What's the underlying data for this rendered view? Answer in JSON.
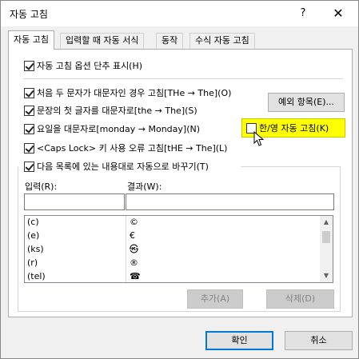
{
  "window": {
    "title": "자동 고침",
    "help": "?",
    "close": "✕"
  },
  "tabs": [
    {
      "label": "자동 고침",
      "active": true
    },
    {
      "label": "입력할 때 자동 서식",
      "active": false
    },
    {
      "label": "동작",
      "active": false
    },
    {
      "label": "수식 자동 고침",
      "active": false
    }
  ],
  "options": {
    "show_buttons": "자동 고침 옵션 단추 표시(H)",
    "two_initial_caps": "처음 두 문자가 대문자인 경우 고침[THe → The](O)",
    "capitalize_sentence": "문장의 첫 글자를 대문자로[the → The](S)",
    "capitalize_days": "요일을 대문자로[monday → Monday](N)",
    "caps_lock": "<Caps Lock> 키 사용 오류 고침[tHE → The](L)",
    "replace_text": "다음 목록에 있는 내용대로 자동으로 바꾸기(T)",
    "hangul_english": "한/영 자동 고침(K)"
  },
  "buttons": {
    "exceptions": "예외 항목(E)...",
    "add": "추가(A)",
    "delete": "삭제(D)",
    "ok": "확인",
    "cancel": "취소"
  },
  "labels": {
    "replace": "입력(R):",
    "with": "결과(W):"
  },
  "fields": {
    "replace_value": "",
    "with_value": ""
  },
  "list": {
    "rows": [
      {
        "input": "(c)",
        "result": "©"
      },
      {
        "input": "(e)",
        "result": "€"
      },
      {
        "input": "(ks)",
        "result": "㉿"
      },
      {
        "input": "(r)",
        "result": "®"
      },
      {
        "input": "(tel)",
        "result": "☎"
      }
    ]
  },
  "colors": {
    "highlight": "#ffff00",
    "accent": "#0078d7"
  }
}
